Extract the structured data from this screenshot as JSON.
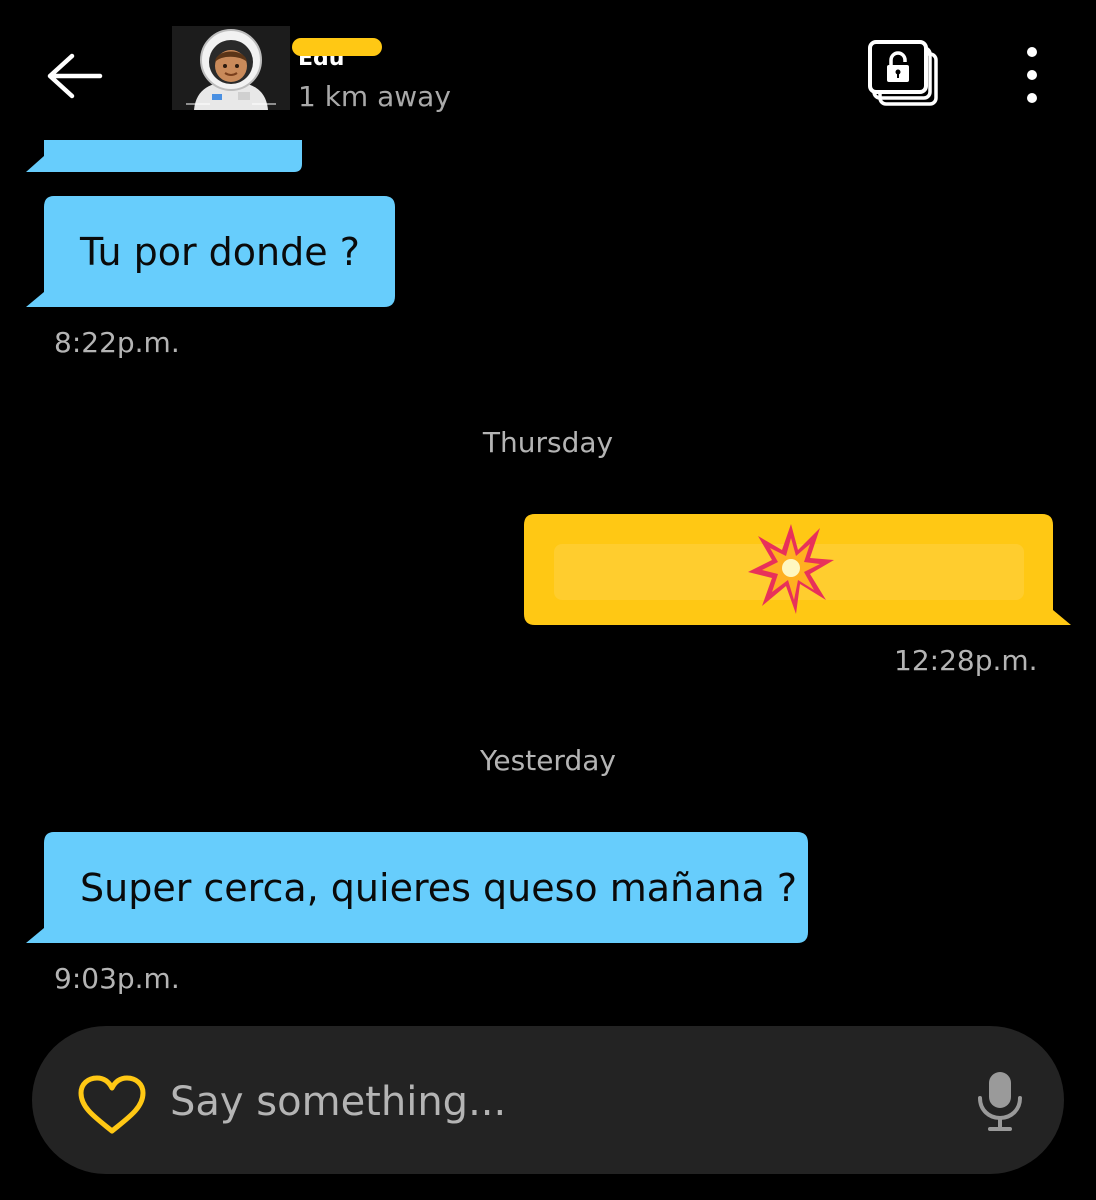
{
  "header": {
    "contact_name": "Edu",
    "distance": "1 km away"
  },
  "colors": {
    "incoming_bubble": "#67cdfc",
    "outgoing_bubble": "#ffc814",
    "background": "#000000",
    "composer": "#232323"
  },
  "messages": [
    {
      "direction": "incoming",
      "text": "",
      "note": ""
    },
    {
      "direction": "incoming",
      "text": "Tu por donde ?",
      "time": "8:22p.m."
    },
    {
      "direction": "outgoing",
      "text": "💥",
      "time": "12:28p.m."
    },
    {
      "direction": "incoming",
      "text": "Super cerca, quieres queso mañana ?",
      "time": "9:03p.m."
    }
  ],
  "day_separators": {
    "thursday": "Thursday",
    "yesterday": "Yesterday"
  },
  "composer": {
    "placeholder": "Say something..."
  },
  "icons": {
    "back": "arrow-left-icon",
    "album": "locked-album-icon",
    "more": "more-vertical-icon",
    "heart": "heart-icon",
    "mic": "microphone-icon"
  }
}
